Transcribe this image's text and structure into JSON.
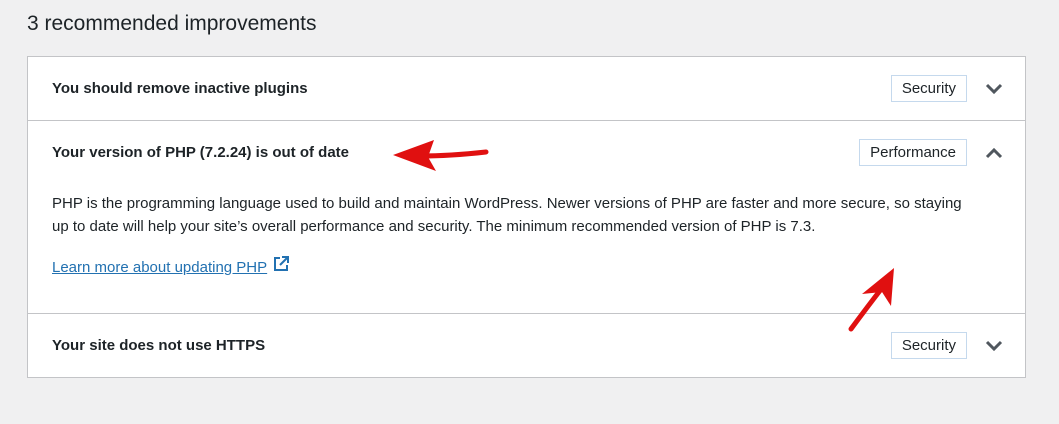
{
  "section_heading": "3 recommended improvements",
  "items": [
    {
      "title": "You should remove inactive plugins",
      "badge": "Security",
      "expanded": false,
      "toggle_icon": "chevron-down-icon"
    },
    {
      "title": "Your version of PHP (7.2.24) is out of date",
      "badge": "Performance",
      "expanded": true,
      "toggle_icon": "chevron-up-icon",
      "description": "PHP is the programming language used to build and maintain WordPress. Newer versions of PHP are faster and more secure, so staying up to date will help your site’s overall performance and security. The minimum recommended version of PHP is 7.3.",
      "link_text": "Learn more about updating PHP",
      "link_icon": "external-link-icon"
    },
    {
      "title": "Your site does not use HTTPS",
      "badge": "Security",
      "expanded": false,
      "toggle_icon": "chevron-down-icon"
    }
  ],
  "colors": {
    "link": "#2271b1",
    "badge_border": "#c5d9ed",
    "annotation_arrow": "#e01010"
  }
}
